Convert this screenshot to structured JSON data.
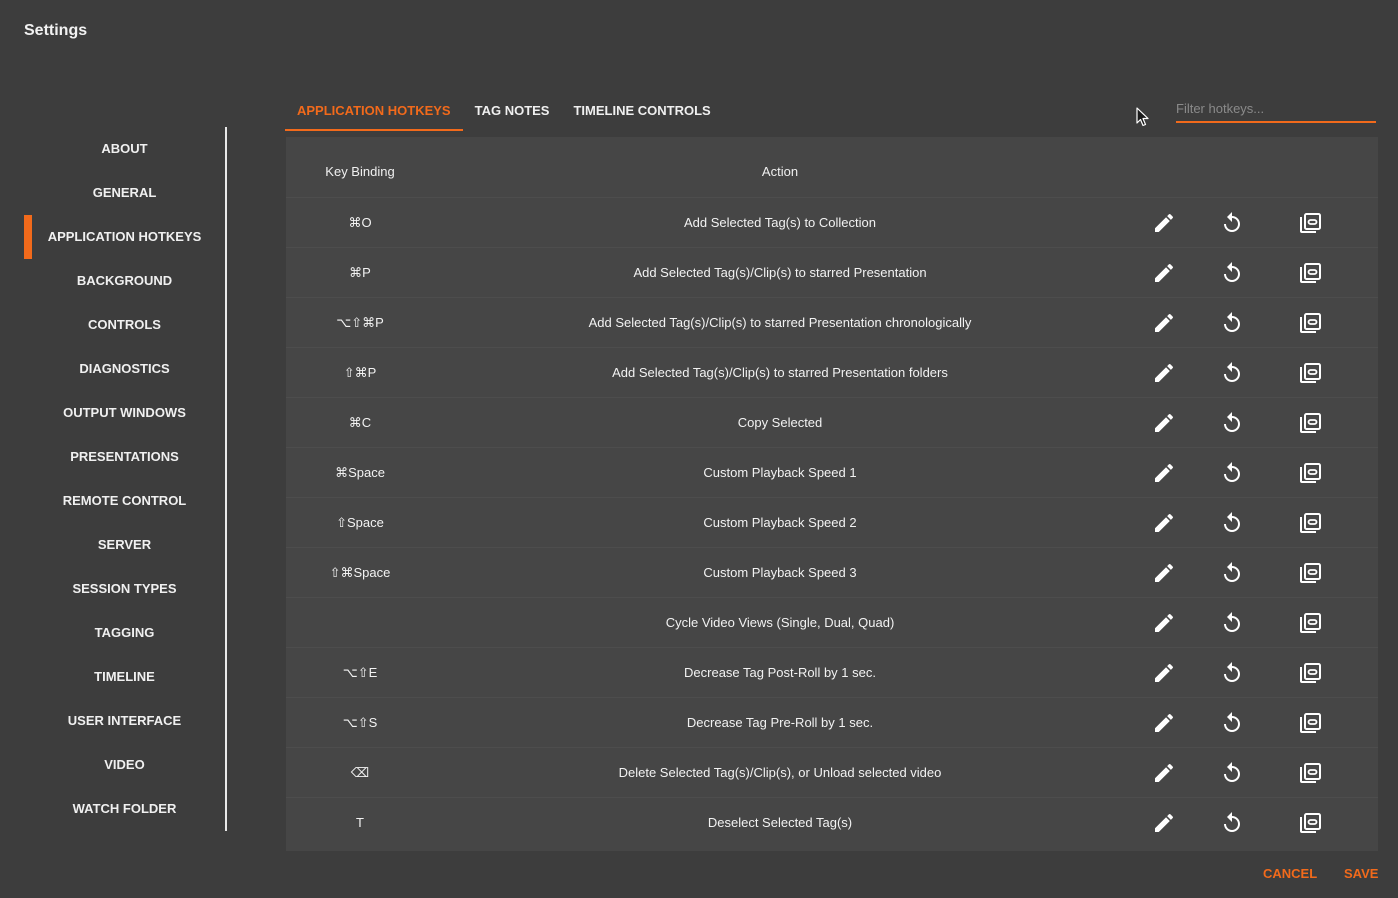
{
  "window": {
    "title": "Settings"
  },
  "colors": {
    "accent": "#f26a1b",
    "background": "#3d3d3d",
    "panel": "#464646"
  },
  "sidebar": {
    "items": [
      {
        "label": "ABOUT"
      },
      {
        "label": "GENERAL"
      },
      {
        "label": "APPLICATION HOTKEYS",
        "active": true
      },
      {
        "label": "BACKGROUND"
      },
      {
        "label": "CONTROLS"
      },
      {
        "label": "DIAGNOSTICS"
      },
      {
        "label": "OUTPUT WINDOWS"
      },
      {
        "label": "PRESENTATIONS"
      },
      {
        "label": "REMOTE CONTROL"
      },
      {
        "label": "SERVER"
      },
      {
        "label": "SESSION TYPES"
      },
      {
        "label": "TAGGING"
      },
      {
        "label": "TIMELINE"
      },
      {
        "label": "USER INTERFACE"
      },
      {
        "label": "VIDEO"
      },
      {
        "label": "WATCH FOLDER"
      }
    ]
  },
  "tabs": [
    {
      "label": "APPLICATION HOTKEYS",
      "active": true
    },
    {
      "label": "TAG NOTES"
    },
    {
      "label": "TIMELINE CONTROLS"
    }
  ],
  "filter": {
    "placeholder": "Filter hotkeys...",
    "value": ""
  },
  "table": {
    "headers": {
      "key": "Key Binding",
      "action": "Action"
    },
    "row_icons": [
      "edit-icon",
      "reset-icon",
      "duplicate-icon"
    ],
    "rows": [
      {
        "key": "⌘O",
        "action": "Add Selected Tag(s) to Collection"
      },
      {
        "key": "⌘P",
        "action": "Add Selected Tag(s)/Clip(s) to starred Presentation"
      },
      {
        "key": "⌥⇧⌘P",
        "action": "Add Selected Tag(s)/Clip(s) to starred Presentation chronologically"
      },
      {
        "key": "⇧⌘P",
        "action": "Add Selected Tag(s)/Clip(s) to starred Presentation folders"
      },
      {
        "key": "⌘C",
        "action": "Copy Selected"
      },
      {
        "key": "⌘Space",
        "action": "Custom Playback Speed 1"
      },
      {
        "key": "⇧Space",
        "action": "Custom Playback Speed 2"
      },
      {
        "key": "⇧⌘Space",
        "action": "Custom Playback Speed 3"
      },
      {
        "key": "",
        "action": "Cycle Video Views (Single, Dual, Quad)"
      },
      {
        "key": "⌥⇧E",
        "action": "Decrease Tag Post-Roll by 1 sec."
      },
      {
        "key": "⌥⇧S",
        "action": "Decrease Tag Pre-Roll by 1 sec."
      },
      {
        "key": "⌫",
        "action": "Delete Selected Tag(s)/Clip(s), or Unload selected video"
      },
      {
        "key": "T",
        "action": "Deselect Selected Tag(s)"
      }
    ]
  },
  "footer": {
    "cancel_label": "CANCEL",
    "save_label": "SAVE"
  }
}
